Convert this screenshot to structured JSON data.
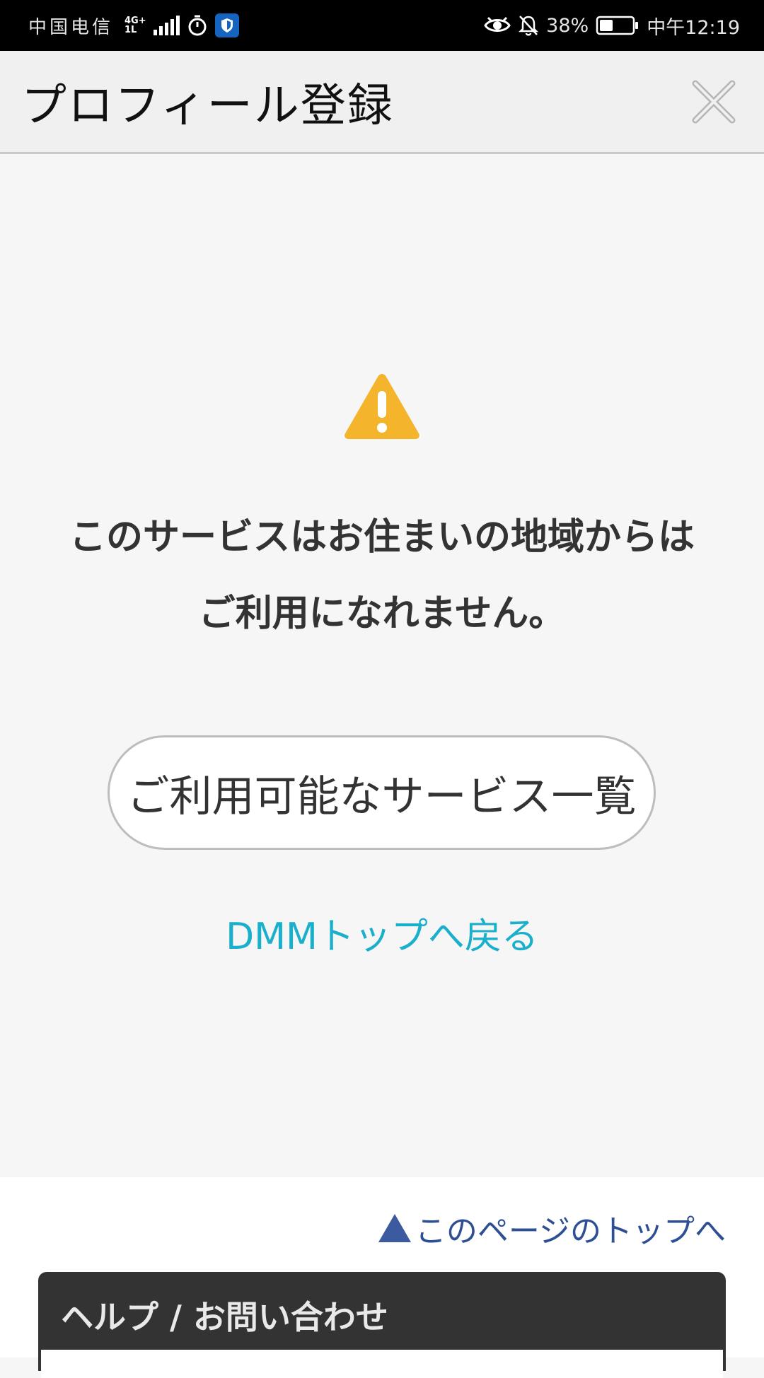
{
  "status_bar": {
    "carrier": "中国电信",
    "network_type_top": "4G+",
    "network_type_bottom": "1L",
    "battery_percent": "38%",
    "time": "中午12:19"
  },
  "header": {
    "title": "プロフィール登録"
  },
  "main": {
    "message_line1": "このサービスはお住まいの地域からは",
    "message_line2": "ご利用になれません。",
    "services_button_label": "ご利用可能なサービス一覧",
    "top_link_label": "DMMトップへ戻る"
  },
  "footer": {
    "page_top_label": "このページのトップへ",
    "help_title": "ヘルプ / お問い合わせ"
  },
  "colors": {
    "warning": "#f4b42b",
    "link_cyan": "#1ab0cc",
    "link_blue": "#2f4f95",
    "help_bg": "#333333"
  },
  "icons": [
    "signal-icon",
    "timer-icon",
    "shield-icon",
    "eye-icon",
    "bell-off-icon",
    "battery-icon",
    "close-icon",
    "warning-icon",
    "up-triangle-icon"
  ]
}
